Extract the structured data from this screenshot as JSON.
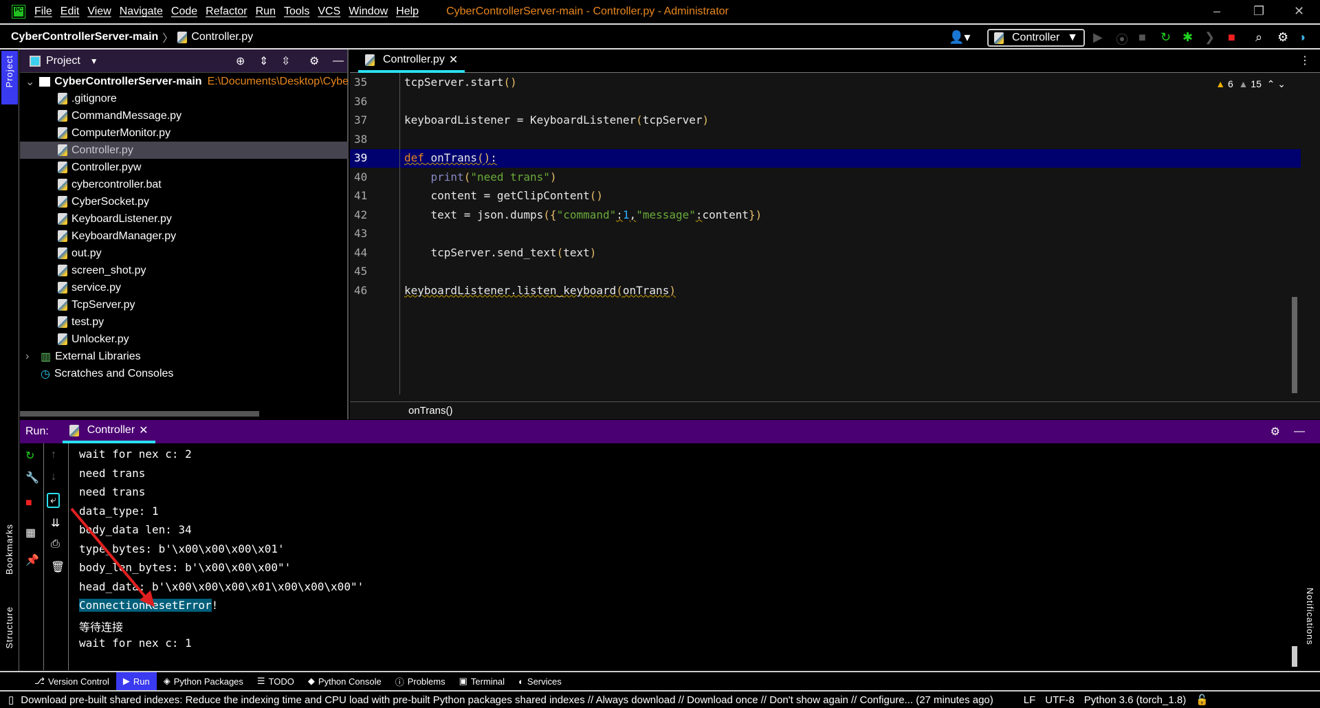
{
  "titlebar": {
    "menus": [
      "File",
      "Edit",
      "View",
      "Navigate",
      "Code",
      "Refactor",
      "Run",
      "Tools",
      "VCS",
      "Window",
      "Help"
    ],
    "title": "CyberControllerServer-main - Controller.py - Administrator"
  },
  "navbar": {
    "project": "CyberControllerServer-main",
    "file": "Controller.py",
    "run_config": "Controller"
  },
  "stripe": {
    "project": "Project",
    "bookmarks": "Bookmarks",
    "structure": "Structure",
    "notifications": "Notifications"
  },
  "project": {
    "title": "Project",
    "root": "CyberControllerServer-main",
    "root_path": "E:\\Documents\\Desktop\\Cybe",
    "files": [
      ".gitignore",
      "CommandMessage.py",
      "ComputerMonitor.py",
      "Controller.py",
      "Controller.pyw",
      "cybercontroller.bat",
      "CyberSocket.py",
      "KeyboardListener.py",
      "KeyboardManager.py",
      "out.py",
      "screen_shot.py",
      "service.py",
      "TcpServer.py",
      "test.py",
      "Unlocker.py"
    ],
    "selected": "Controller.py",
    "external": "External Libraries",
    "scratches": "Scratches and Consoles"
  },
  "editor": {
    "tab": "Controller.py",
    "warnings": "6",
    "weak_warnings": "15",
    "breadcrumb": "onTrans()",
    "line_numbers": [
      "35",
      "36",
      "37",
      "38",
      "39",
      "40",
      "41",
      "42",
      "43",
      "44",
      "45",
      "46"
    ],
    "current_line": "39"
  },
  "run": {
    "label": "Run:",
    "tab": "Controller",
    "output": [
      "wait for nex c: 2",
      "need trans",
      "need trans",
      "data_type: 1",
      "body_data len: 34",
      "type_bytes: b'\\x00\\x00\\x00\\x01'",
      "body_len_bytes: b'\\x00\\x00\\x00\"'",
      "head_data: b'\\x00\\x00\\x00\\x01\\x00\\x00\\x00\"'",
      "ConnectionResetError",
      "!",
      "等待连接",
      "wait for nex c: 1"
    ]
  },
  "bottom_tabs": [
    "Version Control",
    "Run",
    "Python Packages",
    "TODO",
    "Python Console",
    "Problems",
    "Terminal",
    "Services"
  ],
  "status": {
    "message": "Download pre-built shared indexes: Reduce the indexing time and CPU load with pre-built Python packages shared indexes // Always download // Download once // Don't show again // Configure... (27 minutes ago)",
    "line_sep": "LF",
    "encoding": "UTF-8",
    "interpreter": "Python 3.6 (torch_1.8)"
  },
  "colors": {
    "accent": "#2be0f0",
    "run_header": "#4a0072",
    "current_line": "#00006e",
    "keyword": "#e8871e",
    "string": "#6aab3a"
  }
}
